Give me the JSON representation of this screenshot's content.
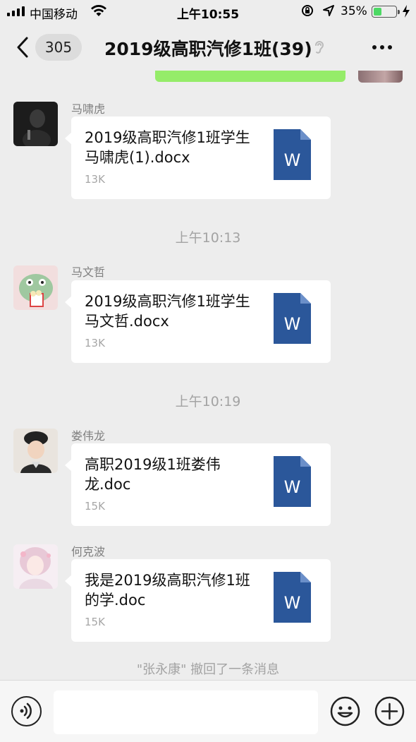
{
  "status_bar": {
    "carrier": "中国移动",
    "time": "上午10:55",
    "battery_percent": "35%",
    "battery_level": 0.35,
    "icons": [
      "signal-icon",
      "wifi-icon",
      "rotation-lock-icon",
      "location-icon",
      "battery-icon",
      "charging-icon"
    ]
  },
  "nav": {
    "back_icon": "chevron-left-icon",
    "unread_count": "305",
    "title": "2019级高职汽修1班(39)",
    "muted_icon": "ear-icon",
    "more_icon": "more-icon"
  },
  "messages": [
    {
      "sender": "马啸虎",
      "file_name": "2019级高职汽修1班学生马啸虎(1).docx",
      "file_size": "13K",
      "file_type_icon": "word-file-icon"
    },
    {
      "timestamp": "上午10:13",
      "sender": "马文哲",
      "file_name": "2019级高职汽修1班学生马文哲.docx",
      "file_size": "13K",
      "file_type_icon": "word-file-icon"
    },
    {
      "timestamp": "上午10:19",
      "sender": "娄伟龙",
      "file_name": "高职2019级1班娄伟龙.doc",
      "file_size": "15K",
      "file_type_icon": "word-file-icon"
    },
    {
      "sender": "何克波",
      "file_name": "我是2019级高职汽修1班的学.doc",
      "file_size": "15K",
      "file_type_icon": "word-file-icon"
    }
  ],
  "recall_notice": "\"张永康\" 撤回了一条消息",
  "word_icon_letter": "W",
  "colors": {
    "background": "#ededed",
    "sent_bubble": "#95ec69",
    "word_blue": "#2b579a",
    "battery_green": "#4cd964"
  },
  "input_bar": {
    "voice_icon": "voice-icon",
    "emoji_icon": "emoji-icon",
    "plus_icon": "plus-icon",
    "input_value": ""
  }
}
